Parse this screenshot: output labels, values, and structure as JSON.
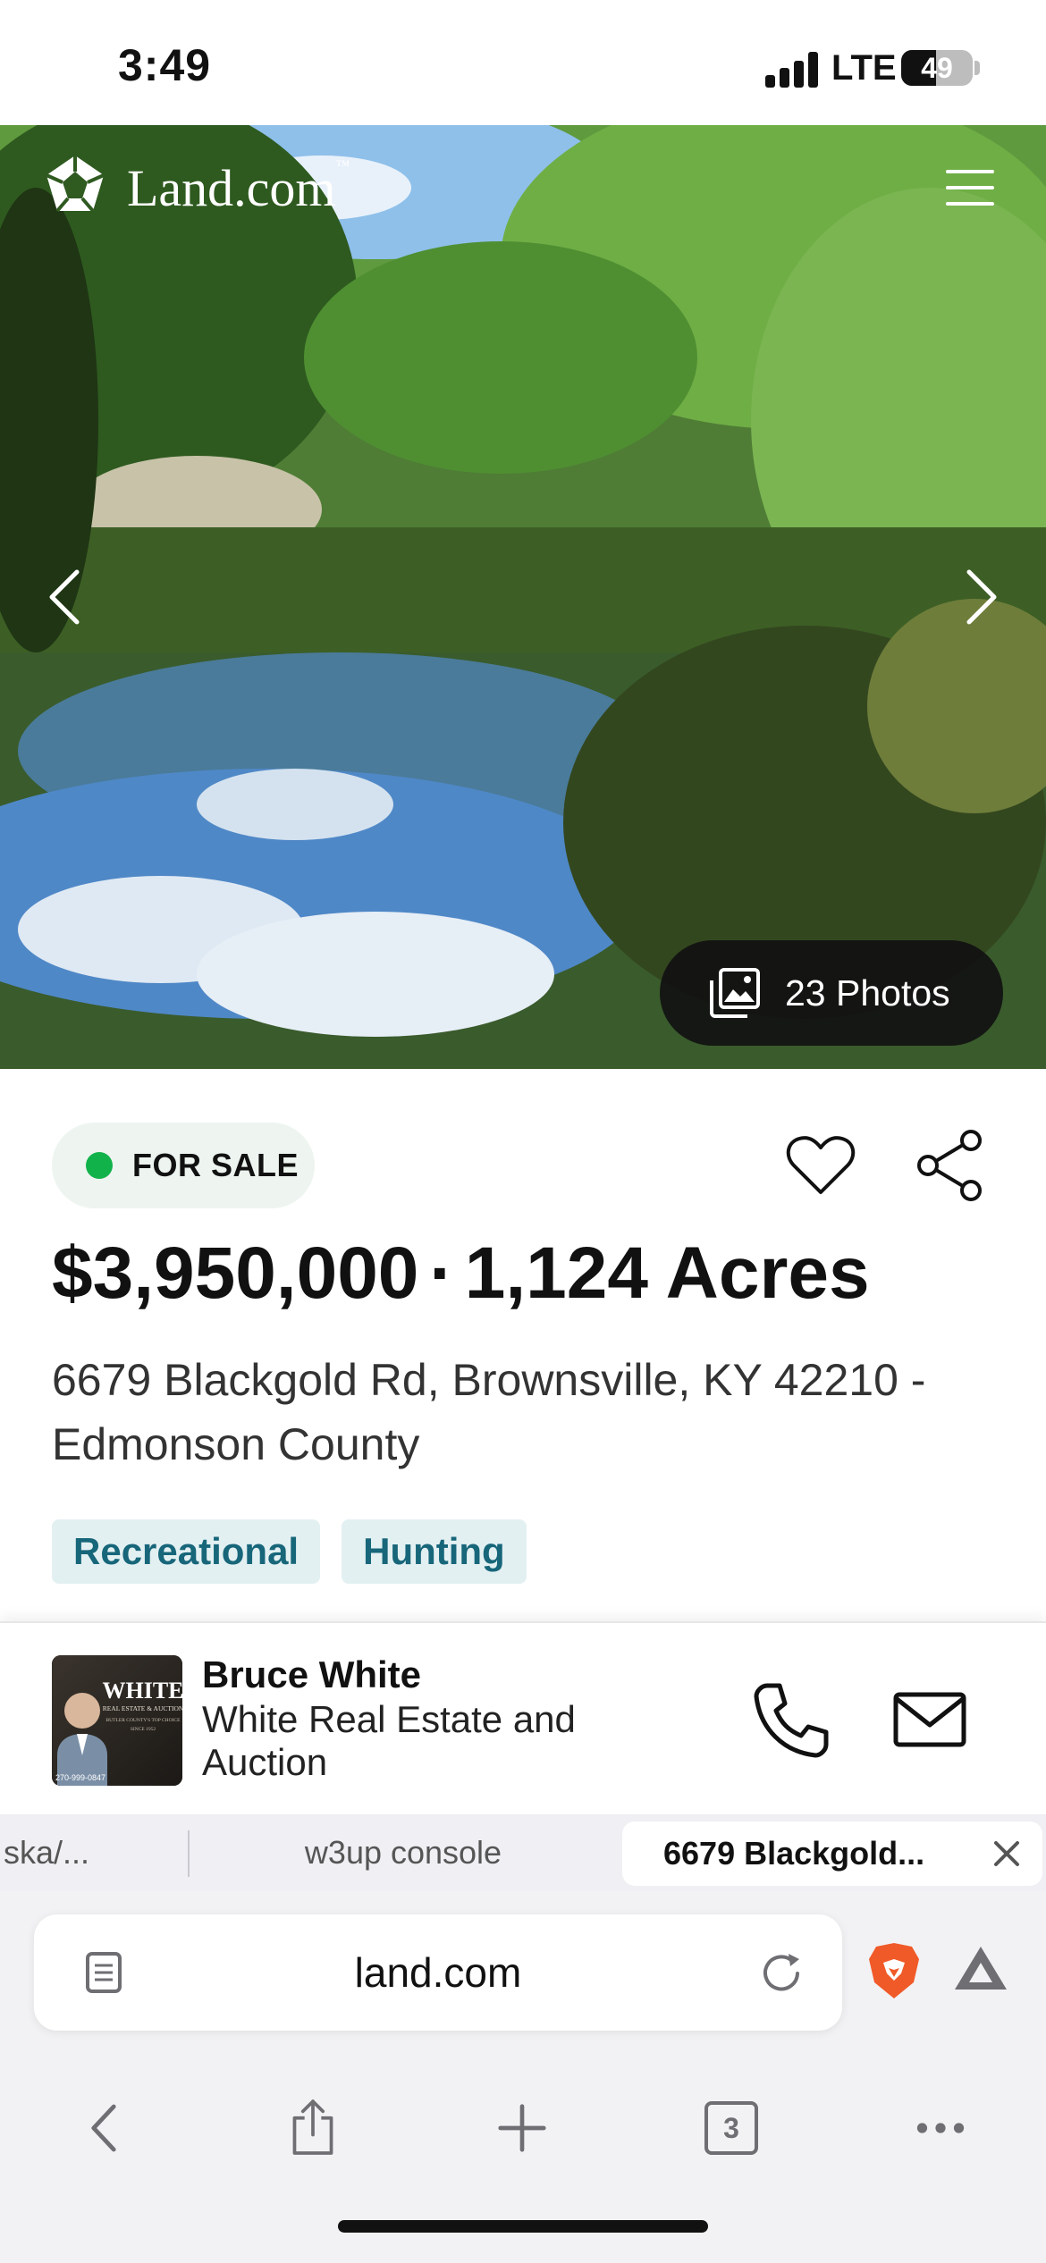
{
  "status_bar": {
    "time": "3:49",
    "network": "LTE",
    "battery_level": "49",
    "battery_percent": 49,
    "signal_icon": "signal-bars-icon"
  },
  "site": {
    "logo_text": "Land.com",
    "logo_tm": "™",
    "logo_icon": "land-logo-icon",
    "menu_icon": "hamburger-menu-icon"
  },
  "gallery": {
    "photos_label": "23 Photos",
    "prev_icon": "chevron-left-icon",
    "next_icon": "chevron-right-icon",
    "photos_icon": "image-stack-icon"
  },
  "listing": {
    "status": "FOR SALE",
    "status_color": "#12b24b",
    "price": "$3,950,000",
    "separator": "·",
    "acres": "1,124 Acres",
    "address_line": "6679 Blackgold Rd, Brownsville, KY 42210 - Edmonson County",
    "tags": [
      "Recreational",
      "Hunting"
    ],
    "favorite_icon": "heart-icon",
    "share_icon": "share-icon"
  },
  "agent": {
    "name": "Bruce White",
    "company": "White Real Estate and Auction",
    "photo_brand": "WHITE",
    "photo_subtitle": "REAL ESTATE & AUCTION",
    "photo_tagline": "BUTLER COUNTY'S TOP CHOICE",
    "photo_since": "SINCE 1952",
    "photo_phone": "270-999-0847",
    "call_icon": "phone-icon",
    "mail_icon": "envelope-icon"
  },
  "browser": {
    "tabs": [
      {
        "label": "ska/..."
      },
      {
        "label": "w3up console"
      },
      {
        "label": "6679 Blackgold..."
      }
    ],
    "url": "land.com",
    "tab_count": "3",
    "accent_brave": "#f05a28",
    "nav": [
      "back-icon",
      "share-sheet-icon",
      "new-tab-icon",
      "tabs-icon",
      "more-icon"
    ]
  }
}
